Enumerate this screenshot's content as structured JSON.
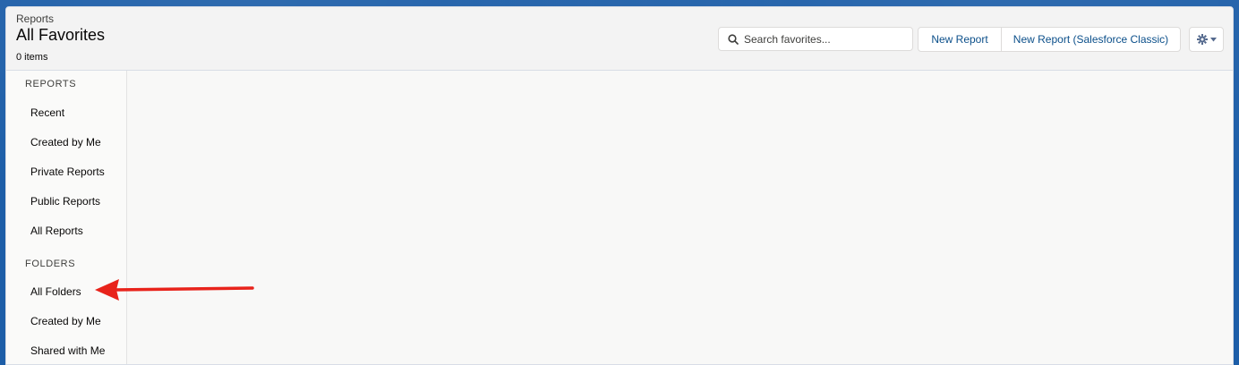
{
  "header": {
    "eyebrow": "Reports",
    "title": "All Favorites",
    "item_count": "0 items"
  },
  "search": {
    "placeholder": "Search favorites..."
  },
  "actions": {
    "new_report": "New Report",
    "new_report_classic": "New Report (Salesforce Classic)"
  },
  "sidebar": {
    "reports_heading": "REPORTS",
    "reports_items": [
      "Recent",
      "Created by Me",
      "Private Reports",
      "Public Reports",
      "All Reports"
    ],
    "folders_heading": "FOLDERS",
    "folders_items": [
      "All Folders",
      "Created by Me",
      "Shared with Me"
    ]
  },
  "colors": {
    "annotation_arrow": "#e8231b",
    "link_blue": "#0b4f8a",
    "backdrop_blue": "#1d5ea8"
  }
}
